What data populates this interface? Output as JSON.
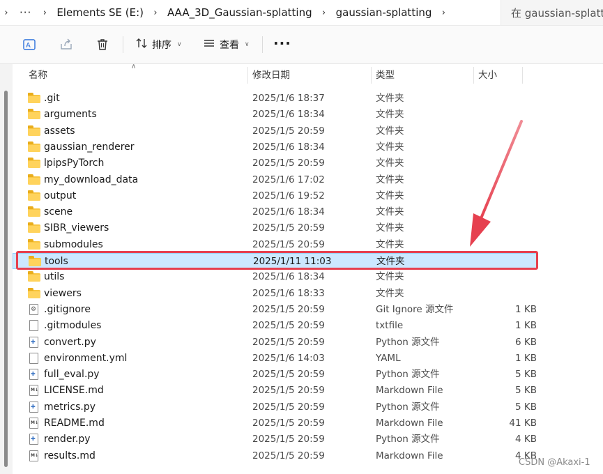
{
  "address": {
    "path": [
      "Elements SE (E:)",
      "AAA_3D_Gaussian-splatting",
      "gaussian-splatting"
    ],
    "search_placeholder": "在 gaussian-splatting"
  },
  "toolbar": {
    "sort_label": "排序",
    "view_label": "查看",
    "more_label": "···"
  },
  "columns": {
    "name": "名称",
    "date": "修改日期",
    "type": "类型",
    "size": "大小"
  },
  "files": [
    {
      "name": ".git",
      "date": "2025/1/6 18:37",
      "type": "文件夹",
      "size": "",
      "icon": "folder-icon"
    },
    {
      "name": "arguments",
      "date": "2025/1/6 18:34",
      "type": "文件夹",
      "size": "",
      "icon": "folder-icon"
    },
    {
      "name": "assets",
      "date": "2025/1/5 20:59",
      "type": "文件夹",
      "size": "",
      "icon": "folder-icon"
    },
    {
      "name": "gaussian_renderer",
      "date": "2025/1/6 18:34",
      "type": "文件夹",
      "size": "",
      "icon": "folder-icon"
    },
    {
      "name": "lpipsPyTorch",
      "date": "2025/1/5 20:59",
      "type": "文件夹",
      "size": "",
      "icon": "folder-icon"
    },
    {
      "name": "my_download_data",
      "date": "2025/1/6 17:02",
      "type": "文件夹",
      "size": "",
      "icon": "folder-icon"
    },
    {
      "name": "output",
      "date": "2025/1/6 19:52",
      "type": "文件夹",
      "size": "",
      "icon": "folder-icon"
    },
    {
      "name": "scene",
      "date": "2025/1/6 18:34",
      "type": "文件夹",
      "size": "",
      "icon": "folder-icon"
    },
    {
      "name": "SIBR_viewers",
      "date": "2025/1/5 20:59",
      "type": "文件夹",
      "size": "",
      "icon": "folder-icon"
    },
    {
      "name": "submodules",
      "date": "2025/1/5 20:59",
      "type": "文件夹",
      "size": "",
      "icon": "folder-icon"
    },
    {
      "name": "tools",
      "date": "2025/1/11 11:03",
      "type": "文件夹",
      "size": "",
      "icon": "folder-icon",
      "selected": true
    },
    {
      "name": "utils",
      "date": "2025/1/6 18:34",
      "type": "文件夹",
      "size": "",
      "icon": "folder-icon"
    },
    {
      "name": "viewers",
      "date": "2025/1/6 18:33",
      "type": "文件夹",
      "size": "",
      "icon": "folder-icon"
    },
    {
      "name": ".gitignore",
      "date": "2025/1/5 20:59",
      "type": "Git Ignore 源文件",
      "size": "1 KB",
      "icon": "gear-file-icon"
    },
    {
      "name": ".gitmodules",
      "date": "2025/1/5 20:59",
      "type": "txtfile",
      "size": "1 KB",
      "icon": "file-icon"
    },
    {
      "name": "convert.py",
      "date": "2025/1/5 20:59",
      "type": "Python 源文件",
      "size": "6 KB",
      "icon": "python-file-icon"
    },
    {
      "name": "environment.yml",
      "date": "2025/1/6 14:03",
      "type": "YAML",
      "size": "1 KB",
      "icon": "file-icon"
    },
    {
      "name": "full_eval.py",
      "date": "2025/1/5 20:59",
      "type": "Python 源文件",
      "size": "5 KB",
      "icon": "python-file-icon"
    },
    {
      "name": "LICENSE.md",
      "date": "2025/1/5 20:59",
      "type": "Markdown File",
      "size": "5 KB",
      "icon": "markdown-file-icon"
    },
    {
      "name": "metrics.py",
      "date": "2025/1/5 20:59",
      "type": "Python 源文件",
      "size": "5 KB",
      "icon": "python-file-icon"
    },
    {
      "name": "README.md",
      "date": "2025/1/5 20:59",
      "type": "Markdown File",
      "size": "41 KB",
      "icon": "markdown-file-icon"
    },
    {
      "name": "render.py",
      "date": "2025/1/5 20:59",
      "type": "Python 源文件",
      "size": "4 KB",
      "icon": "python-file-icon"
    },
    {
      "name": "results.md",
      "date": "2025/1/5 20:59",
      "type": "Markdown File",
      "size": "4 KB",
      "icon": "markdown-file-icon"
    }
  ],
  "watermark": "CSDN @Akaxi-1",
  "colors": {
    "selection_bg": "#cce8ff",
    "annotation_red": "#e6404f",
    "folder_yellow": "#f8c540"
  }
}
